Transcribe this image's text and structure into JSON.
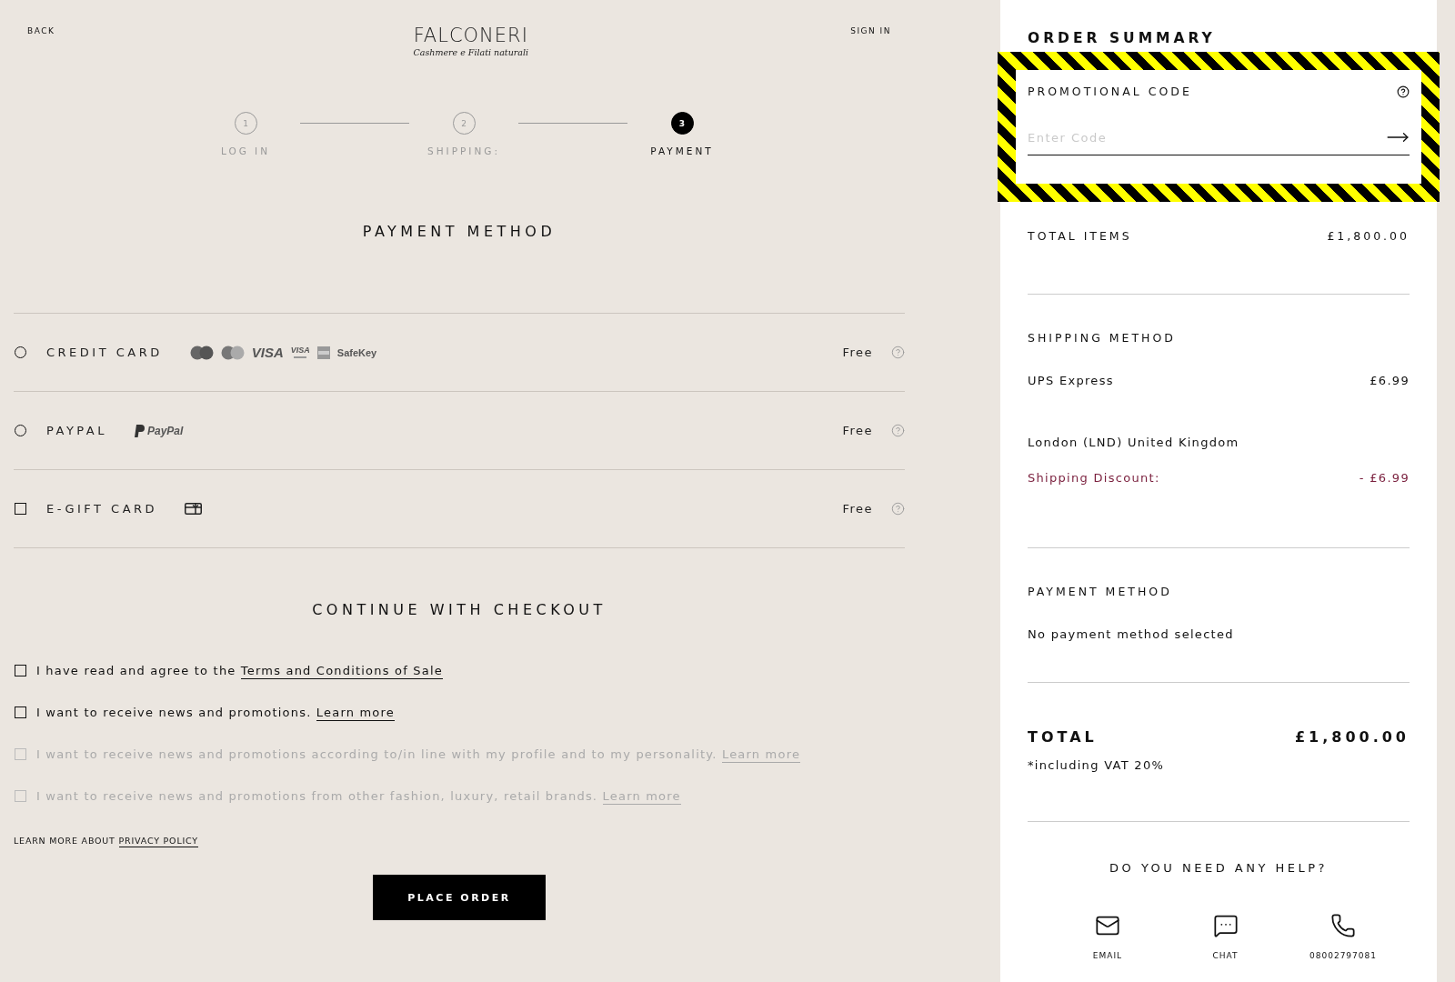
{
  "header": {
    "back": "BACK",
    "brand": "FALCONERI",
    "tagline": "Cashmere e Filati naturali",
    "sign_in": "SIGN IN"
  },
  "steps": [
    {
      "number": "1",
      "label": "LOG IN",
      "selected": false
    },
    {
      "number": "2",
      "label": "SHIPPING:",
      "selected": false
    },
    {
      "number": "3",
      "label": "PAYMENT",
      "selected": true
    }
  ],
  "payment_title": "PAYMENT METHOD",
  "payment_methods": [
    {
      "kind": "radio",
      "checked": false,
      "label": "CREDIT CARD",
      "price": "Free",
      "logos": [
        {
          "kind": "maestro"
        },
        {
          "kind": "mastercard"
        },
        {
          "kind": "visa",
          "text": "VISA"
        },
        {
          "kind": "visa-electron",
          "text": "VISA"
        },
        {
          "kind": "amex"
        },
        {
          "kind": "safekey",
          "text": "SafeKey"
        }
      ]
    },
    {
      "kind": "radio",
      "checked": false,
      "label": "PAYPAL",
      "price": "Free",
      "logos": [
        {
          "kind": "paypal",
          "text": "PayPal"
        }
      ]
    },
    {
      "kind": "checkbox",
      "checked": false,
      "label": "E-GIFT CARD",
      "price": "Free",
      "logos": [
        {
          "kind": "gift-card"
        }
      ]
    }
  ],
  "checkout_title": "CONTINUE WITH CHECKOUT",
  "consents": [
    {
      "checked": false,
      "disabled": false,
      "text": "I have read and agree to the ",
      "link": "Terms and Conditions of Sale"
    },
    {
      "checked": false,
      "disabled": false,
      "text": "I want to receive news and promotions. ",
      "link": "Learn more"
    },
    {
      "checked": false,
      "disabled": true,
      "text": "I want to receive news and promotions according to/in line with my profile and to my personality. ",
      "link": "Learn more"
    },
    {
      "checked": false,
      "disabled": true,
      "text": "I want to receive news and promotions from other fashion, luxury, retail brands. ",
      "link": "Learn more"
    }
  ],
  "privacy": {
    "text": "LEARN MORE ABOUT ",
    "link": "PRIVACY POLICY"
  },
  "place_order": "PLACE ORDER",
  "summary": {
    "title": "ORDER SUMMARY",
    "promo": {
      "label": "PROMOTIONAL CODE",
      "placeholder": "Enter Code"
    },
    "total_items": {
      "label": "TOTAL ITEMS",
      "value": "£1,800.00"
    },
    "shipping": {
      "title": "SHIPPING METHOD",
      "method": "UPS Express",
      "price": "£6.99",
      "address": "London (LND) United Kingdom",
      "discount_label": "Shipping Discount:",
      "discount_value": "- £6.99"
    },
    "payment": {
      "title": "PAYMENT METHOD",
      "value": "No payment method selected"
    },
    "total": {
      "label": "TOTAL",
      "value": "£1,800.00",
      "note": "*including VAT 20%"
    },
    "help": {
      "title": "DO YOU NEED ANY HELP?",
      "contacts": [
        {
          "kind": "email",
          "label": "EMAIL"
        },
        {
          "kind": "chat",
          "label": "CHAT"
        },
        {
          "kind": "phone",
          "label": "08002797081"
        }
      ]
    }
  }
}
